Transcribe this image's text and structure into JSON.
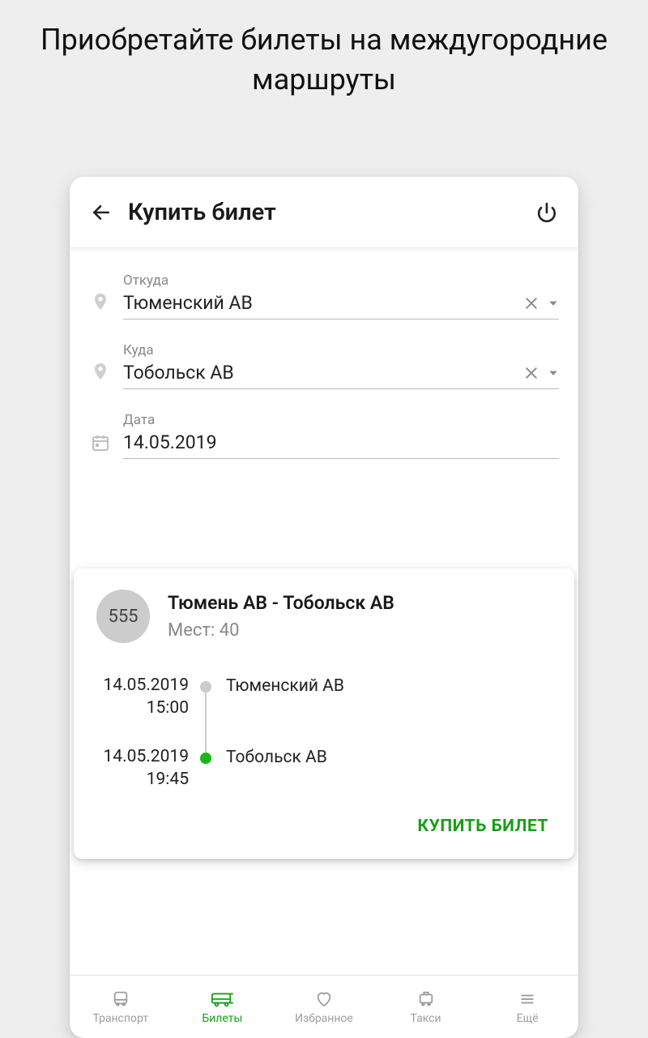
{
  "promo": {
    "title": "Приобретайте билеты на междугородние маршруты"
  },
  "header": {
    "title": "Купить билет"
  },
  "form": {
    "from": {
      "label": "Откуда",
      "value": "Тюменский АВ"
    },
    "to": {
      "label": "Куда",
      "value": "Тобольск АВ"
    },
    "date": {
      "label": "Дата",
      "value": "14.05.2019"
    }
  },
  "result": {
    "route_number": "555",
    "route_name": "Тюмень АВ - Тобольск АВ",
    "seats_label": "Мест: 40",
    "stops": [
      {
        "date": "14.05.2019",
        "time": "15:00",
        "station": "Тюменский АВ"
      },
      {
        "date": "14.05.2019",
        "time": "19:45",
        "station": "Тобольск АВ"
      }
    ],
    "buy_label": "КУПИТЬ БИЛЕТ"
  },
  "nav": {
    "items": [
      {
        "label": "Транспорт"
      },
      {
        "label": "Билеты"
      },
      {
        "label": "Избранное"
      },
      {
        "label": "Такси"
      },
      {
        "label": "Ещё"
      }
    ]
  }
}
